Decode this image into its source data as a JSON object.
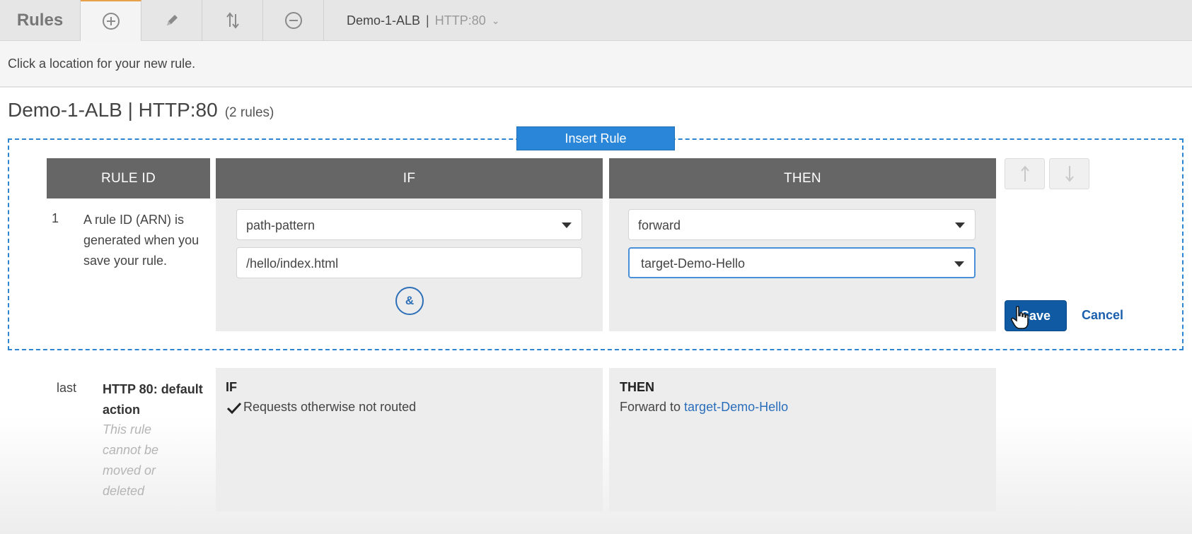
{
  "toolbar": {
    "title": "Rules",
    "add_icon": "plus-circle-icon",
    "edit_icon": "pencil-icon",
    "reorder_icon": "reorder-arrows-icon",
    "delete_icon": "minus-circle-icon",
    "load_balancer": "Demo-1-ALB",
    "separator": "|",
    "listener": "HTTP:80",
    "chevron": "⌄"
  },
  "hint": "Click a location for your new rule.",
  "heading": {
    "title": "Demo-1-ALB | HTTP:80",
    "count": "(2 rules)"
  },
  "insert_rule": {
    "button_label": "Insert Rule",
    "columns": {
      "rule_id": "RULE ID",
      "if": "IF",
      "then": "THEN"
    },
    "rule_number": "1",
    "rule_id_text": "A rule ID (ARN) is generated when you save your rule.",
    "condition_type": "path-pattern",
    "condition_value": "/hello/index.html",
    "and_label": "&",
    "action_type": "forward",
    "target_group": "target-Demo-Hello",
    "save_label": "Save",
    "cancel_label": "Cancel"
  },
  "default_rule": {
    "position": "last",
    "title": "HTTP 80: default action",
    "note": "This rule cannot be moved or deleted",
    "if_heading": "IF",
    "if_text": "Requests otherwise not routed",
    "then_heading": "THEN",
    "then_prefix": "Forward to",
    "then_target": "target-Demo-Hello"
  },
  "colors": {
    "accent": "#2a86d8",
    "save_button": "#0f5aa3",
    "header_bg": "#666666",
    "link": "#2a6ebb"
  }
}
